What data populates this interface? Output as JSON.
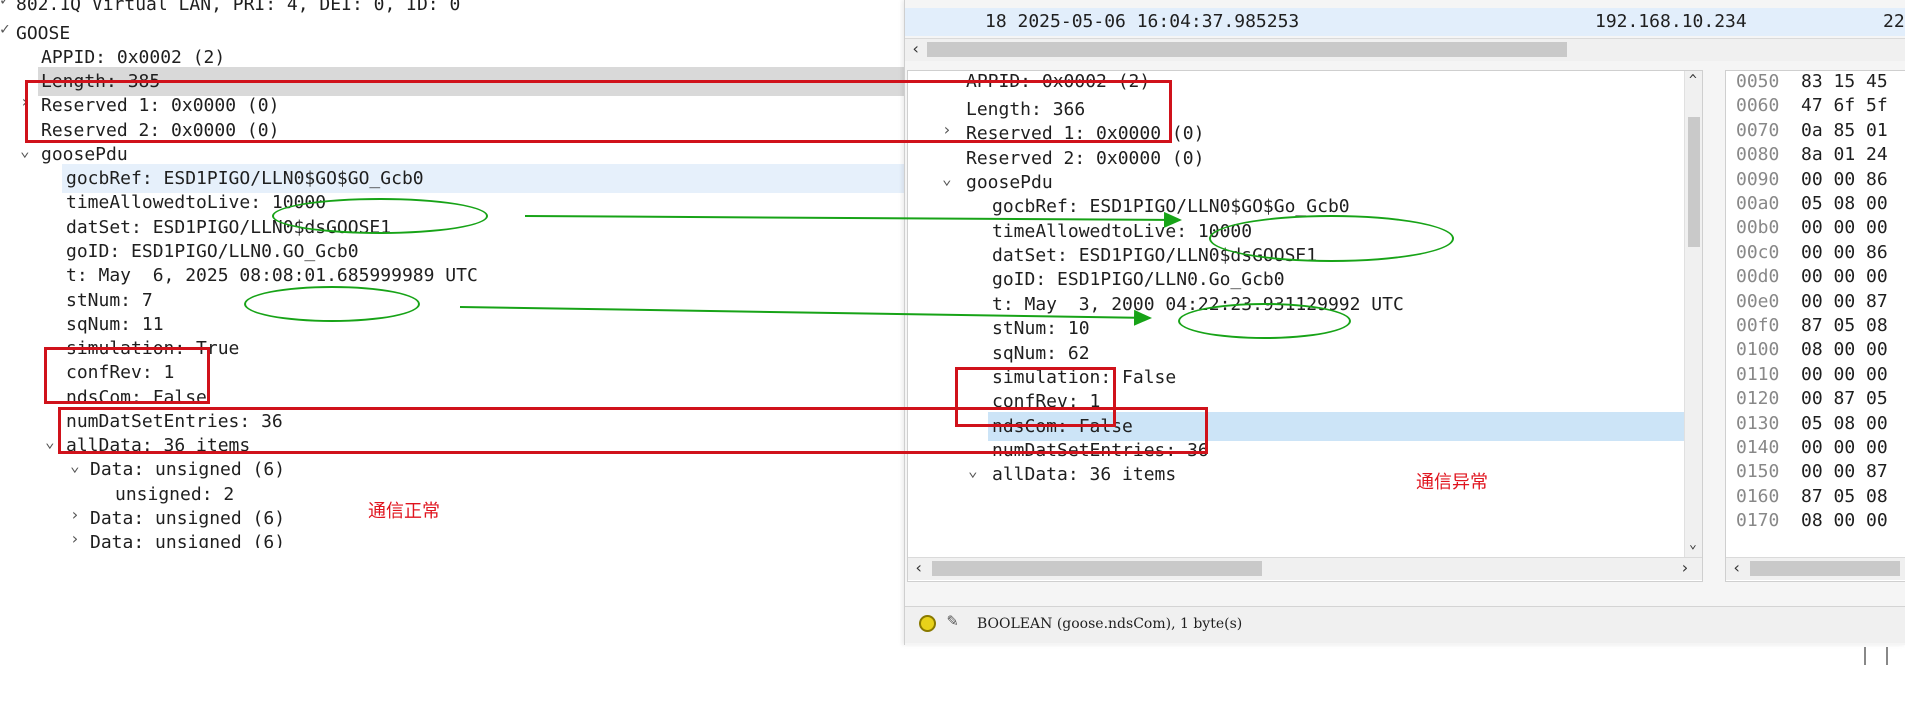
{
  "left_tree": {
    "vlan": "802.1Q Virtual LAN, PRI: 4, DEI: 0, ID: 0",
    "goose": "GOOSE",
    "appid": "APPID: 0x0002 (2)",
    "length": "Length: 385",
    "reserved1": "Reserved 1: 0x0000 (0)",
    "reserved2": "Reserved 2: 0x0000 (0)",
    "goosepdu": "goosePdu",
    "gocbref": "gocbRef: ESD1PIGO/LLN0$GO$GO_Gcb0",
    "timeallowed": "timeAllowedtoLive: 10000",
    "datset": "datSet: ESD1PIGO/LLN0$dsGOOSE1",
    "goid": "goID: ESD1PIGO/LLN0.GO_Gcb0",
    "t": "t: May  6, 2025 08:08:01.685999989 UTC",
    "stnum": "stNum: 7",
    "sqnum": "sqNum: 11",
    "simulation": "simulation: True",
    "confrev": "confRev: 1",
    "ndscom": "ndsCom: False",
    "numdatset": "numDatSetEntries: 36",
    "alldata": "allData: 36 items",
    "data1": "Data: unsigned (6)",
    "unsigned": "unsigned: 2",
    "data2": "Data: unsigned (6)",
    "data3": "Data: unsigned (6)"
  },
  "left_note": "通信正常",
  "packet_row": {
    "no_time": "18 2025-05-06 16:04:37.985253",
    "src": "192.168.10.234",
    "extra": "22"
  },
  "right_tree": {
    "appid": "APPID: 0x0002 (2)",
    "length": "Length: 366",
    "reserved1": "Reserved 1: 0x0000 (0)",
    "reserved2": "Reserved 2: 0x0000 (0)",
    "goosepdu": "goosePdu",
    "gocbref": "gocbRef: ESD1PIGO/LLN0$GO$Go_Gcb0",
    "timeallowed": "timeAllowedtoLive: 10000",
    "datset": "datSet: ESD1PIGO/LLN0$dsGOOSE1",
    "goid": "goID: ESD1PIGO/LLN0.Go_Gcb0",
    "t": "t: May  3, 2000 04:22:23.931129992 UTC",
    "stnum": "stNum: 10",
    "sqnum": "sqNum: 62",
    "simulation": "simulation: False",
    "confrev": "confRev: 1",
    "ndscom": "ndsCom: False",
    "numdatset": "numDatSetEntries: 36",
    "alldata": "allData: 36 items"
  },
  "right_note": "通信异常",
  "hex_rows": [
    {
      "off": "0050",
      "bytes": "83 15 45"
    },
    {
      "off": "0060",
      "bytes": "47 6f 5f"
    },
    {
      "off": "0070",
      "bytes": "0a 85 01"
    },
    {
      "off": "0080",
      "bytes": "8a 01 24"
    },
    {
      "off": "0090",
      "bytes": "00 00 86"
    },
    {
      "off": "00a0",
      "bytes": "05 08 00"
    },
    {
      "off": "00b0",
      "bytes": "00 00 00"
    },
    {
      "off": "00c0",
      "bytes": "00 00 86"
    },
    {
      "off": "00d0",
      "bytes": "00 00 00"
    },
    {
      "off": "00e0",
      "bytes": "00 00 87"
    },
    {
      "off": "00f0",
      "bytes": "87 05 08"
    },
    {
      "off": "0100",
      "bytes": "08 00 00"
    },
    {
      "off": "0110",
      "bytes": "00 00 00"
    },
    {
      "off": "0120",
      "bytes": "00 87 05"
    },
    {
      "off": "0130",
      "bytes": "05 08 00"
    },
    {
      "off": "0140",
      "bytes": "00 00 00"
    },
    {
      "off": "0150",
      "bytes": "00 00 87"
    },
    {
      "off": "0160",
      "bytes": "87 05 08"
    },
    {
      "off": "0170",
      "bytes": "08 00 00"
    }
  ],
  "status": {
    "text": "BOOLEAN (goose.ndsCom), 1 byte(s)",
    "indicator_color": "#e8d21a"
  },
  "colors": {
    "annotation_red": "#d0121b",
    "annotation_green": "#17a317",
    "selected_row": "#cce4f7"
  }
}
